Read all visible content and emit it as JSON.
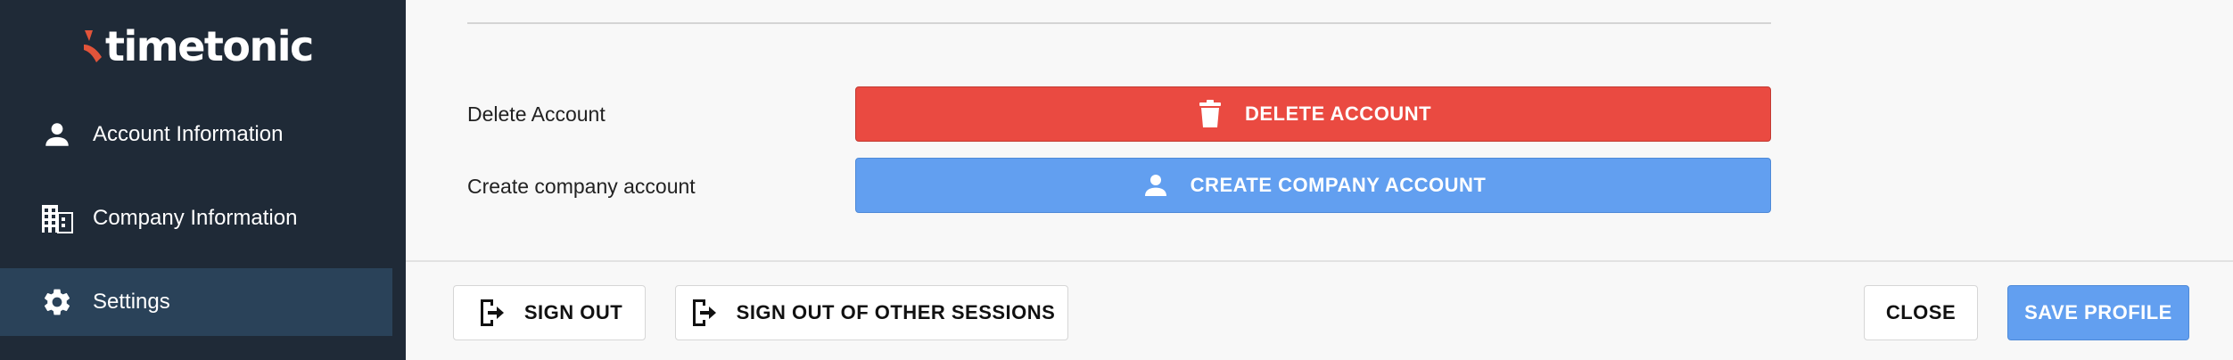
{
  "app": {
    "logo_text": "timetonic",
    "brand_color": "#e2543a"
  },
  "sidebar": {
    "items": [
      {
        "label": "Account Information",
        "icon": "person-icon",
        "active": false
      },
      {
        "label": "Company Information",
        "icon": "building-icon",
        "active": false
      },
      {
        "label": "Settings",
        "icon": "gear-icon",
        "active": true
      }
    ]
  },
  "main": {
    "rows": [
      {
        "label": "Delete Account",
        "button_label": "DELETE ACCOUNT",
        "button_icon": "trash-icon",
        "button_color": "#ea4a41"
      },
      {
        "label": "Create company account",
        "button_label": "CREATE COMPANY ACCOUNT",
        "button_icon": "person-icon",
        "button_color": "#629ff0"
      }
    ]
  },
  "footer": {
    "sign_out_label": "SIGN OUT",
    "sign_out_others_label": "SIGN OUT OF OTHER SESSIONS",
    "close_label": "CLOSE",
    "save_label": "SAVE PROFILE"
  }
}
